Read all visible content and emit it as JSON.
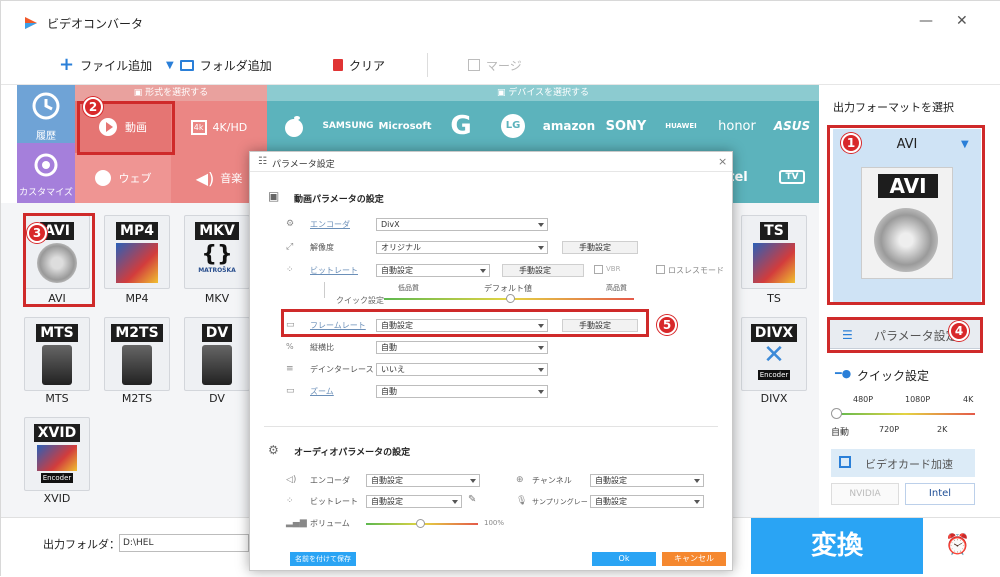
{
  "window": {
    "title": "ビデオコンバータ",
    "minimize": "—",
    "close": "✕"
  },
  "toolbar": {
    "add_file": "ファイル追加",
    "add_folder": "フォルダ追加",
    "clear": "クリア",
    "merge": "マージ"
  },
  "sections": {
    "format_select": "形式を選択する",
    "device_select": "デバイスを選択する"
  },
  "categories": {
    "history": "履歴",
    "custom": "カスタマイズ",
    "video": "動画",
    "hd": "4K/HD",
    "web": "ウェブ",
    "audio": "音楽"
  },
  "brands": [
    "SAMSUNG",
    "Microsoft",
    "G",
    "LG",
    "amazon",
    "SONY",
    "HUAWEI",
    "honor",
    "ASUS",
    "tel",
    "TV"
  ],
  "formats": [
    {
      "tag": "AVI",
      "label": "AVI",
      "sub": ""
    },
    {
      "tag": "MP4",
      "label": "MP4",
      "sub": ""
    },
    {
      "tag": "MKV",
      "label": "MKV",
      "sub": "MATROŠKA"
    },
    {
      "tag": "TS",
      "label": "TS",
      "sub": ""
    },
    {
      "tag": "MTS",
      "label": "MTS",
      "sub": ""
    },
    {
      "tag": "M2TS",
      "label": "M2TS",
      "sub": ""
    },
    {
      "tag": "DV",
      "label": "DV",
      "sub": ""
    },
    {
      "tag": "DIVX",
      "label": "DIVX",
      "sub": "Encoder"
    },
    {
      "tag": "XVID",
      "label": "XVID",
      "sub": "Encoder"
    }
  ],
  "dialog": {
    "title": "パラメータ設定",
    "close": "×",
    "video_header": "動画パラメータの設定",
    "encoder_label": "エンコーダ",
    "encoder_value": "DivX",
    "resolution_label": "解像度",
    "resolution_value": "オリジナル",
    "manual": "手動設定",
    "bitrate_label": "ビットレート",
    "bitrate_value": "自動設定",
    "vbr": "VBR",
    "lossless": "ロスレスモード",
    "quick_label": "クイック設定",
    "low_quality": "低品質",
    "default_value": "デフォルト値",
    "high_quality": "高品質",
    "framerate_label": "フレームレート",
    "framerate_value": "自動設定",
    "aspect_label": "縦横比",
    "aspect_value": "自動",
    "deinterlace_label": "デインターレース",
    "deinterlace_value": "いいえ",
    "zoom_label": "ズーム",
    "zoom_value": "自動",
    "audio_header": "オーディオパラメータの設定",
    "a_encoder_label": "エンコーダ",
    "a_encoder_value": "自動設定",
    "a_bitrate_label": "ビットレート",
    "a_bitrate_value": "自動設定",
    "volume_label": "ボリューム",
    "volume_value": "100%",
    "channel_label": "チャンネル",
    "channel_value": "自動設定",
    "samplerate_label": "サンプリングレート",
    "samplerate_value": "自動設定",
    "save_as": "名前を付けて保存",
    "ok": "Ok",
    "cancel": "キャンセル"
  },
  "right_panel": {
    "output_format_title": "出力フォーマットを選択",
    "selected_format": "AVI",
    "param_button": "パラメータ設定",
    "quick_title": "クイック設定",
    "ticks_top": [
      "480P",
      "1080P",
      "4K"
    ],
    "ticks_bottom": [
      "自動",
      "720P",
      "2K"
    ],
    "gpu_button": "ビデオカード加速",
    "nvidia": "NVIDIA",
    "intel": "Intel"
  },
  "bottom": {
    "output_folder_label": "出力フォルダ：",
    "output_folder_value": "D:\\HEL",
    "convert": "変換"
  },
  "annotations": [
    "1",
    "2",
    "3",
    "4",
    "5"
  ],
  "colors": {
    "red": "#cf2a2a",
    "teal": "#5cb3bc",
    "video_cat": "#e57573",
    "convert": "#2aa4f4",
    "purple": "#9b7ad8"
  }
}
